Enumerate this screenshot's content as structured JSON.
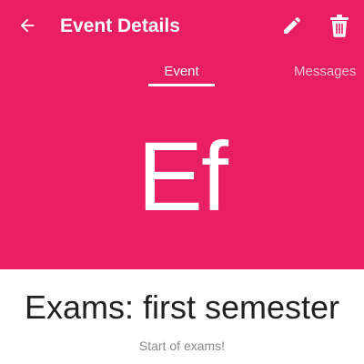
{
  "appbar": {
    "title": "Event Details",
    "back_icon": "arrow-left-icon",
    "edit_icon": "pencil-icon",
    "delete_icon": "trash-icon"
  },
  "tabs": [
    {
      "label": "Event",
      "selected": true
    },
    {
      "label": "Messages",
      "selected": false
    }
  ],
  "event": {
    "initials": "Ef",
    "name": "Exams: first semester",
    "description": "Start of exams!"
  },
  "colors": {
    "accent": "#E91E63",
    "text_primary": "#212121",
    "text_secondary": "#8A8A8A"
  }
}
